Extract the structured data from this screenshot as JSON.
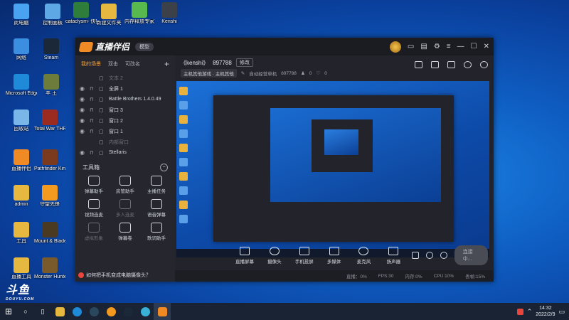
{
  "desktop": {
    "icons": [
      {
        "label": "此电脑",
        "icon": "pc-icon",
        "color": "#4aa3f0"
      },
      {
        "label": "控制面板",
        "icon": "control-panel-icon",
        "color": "#5fa8e6"
      },
      {
        "label": "cataclysm-\n快捷方式",
        "icon": "cataclysm-icon",
        "color": "#2f7d3a"
      },
      {
        "label": "新建文件夹",
        "icon": "folder-icon",
        "color": "#e7b83f"
      },
      {
        "label": "内存释放专家",
        "icon": "memory-tool-icon",
        "color": "#57b94e"
      },
      {
        "label": "Kenshi",
        "icon": "kenshi-icon",
        "color": "#3c4048"
      },
      {
        "label": "网络",
        "icon": "network-icon",
        "color": "#3b8ee0"
      },
      {
        "label": "Steam",
        "icon": "steam-icon",
        "color": "#1b2838"
      },
      {
        "label": "Microsoft Edge",
        "icon": "edge-icon",
        "color": "#1f8ad8"
      },
      {
        "label": "羊 王",
        "icon": "game-icon",
        "color": "#6d7c3a"
      },
      {
        "label": "回收站",
        "icon": "recycle-bin-icon",
        "color": "#7ab7e8"
      },
      {
        "label": "Total War THREE K...",
        "icon": "total-war-icon",
        "color": "#9b2b20"
      },
      {
        "label": "直播伴侣",
        "icon": "douyu-companion-icon",
        "color": "#f08a24"
      },
      {
        "label": "Pathfinder Kingmaker",
        "icon": "pathfinder-icon",
        "color": "#7b3a1e"
      },
      {
        "label": "admin",
        "icon": "user-folder-icon",
        "color": "#e7b83f"
      },
      {
        "label": "守望先锋",
        "icon": "overwatch-icon",
        "color": "#f29a1f"
      },
      {
        "label": "工具",
        "icon": "tools-folder-icon",
        "color": "#e7b83f"
      },
      {
        "label": "Mount & Blade II",
        "icon": "bannerlord-icon",
        "color": "#4a3a22"
      },
      {
        "label": "直播工具",
        "icon": "live-tools-icon",
        "color": "#e7b83f"
      },
      {
        "label": "Monster Hunter: W",
        "icon": "monster-hunter-icon",
        "color": "#7a5a2a"
      }
    ]
  },
  "window": {
    "app_name": "直播伴侣",
    "badge": "模型",
    "room_name": "《kenshi》",
    "room_id": "897788",
    "edit_label": "修改",
    "category": "主机其他游戏 · 主机其他",
    "auto_label": "自动经营单机",
    "viewers": "897788",
    "likes": "0",
    "hearts": "0",
    "sidebar_tabs": [
      "我的场景",
      "双击",
      "可改名"
    ],
    "scenes": [
      {
        "name": "文本 2",
        "dim": true
      },
      {
        "name": "全屏 1",
        "dim": false
      },
      {
        "name": "Battle Brothers 1.4.0.49",
        "dim": false
      },
      {
        "name": "窗口 3",
        "dim": false
      },
      {
        "name": "窗口 2",
        "dim": false
      },
      {
        "name": "窗口 1",
        "dim": false
      },
      {
        "name": "内部窗口",
        "dim": true
      },
      {
        "name": "Stellaris",
        "dim": false
      }
    ],
    "tools_title": "工具箱",
    "tools": [
      {
        "label": "弹幕助手",
        "dim": false
      },
      {
        "label": "房管助手",
        "dim": false
      },
      {
        "label": "主播任务",
        "dim": false
      },
      {
        "label": "视频连麦",
        "dim": false
      },
      {
        "label": "多人连麦",
        "dim": true
      },
      {
        "label": "语音弹幕",
        "dim": false
      },
      {
        "label": "虚拟形象",
        "dim": true
      },
      {
        "label": "弹幕卷",
        "dim": false
      },
      {
        "label": "歌词助手",
        "dim": false
      }
    ],
    "bottom_buttons": [
      "直播屏幕",
      "摄像头",
      "手机投屏",
      "多媒体",
      "麦克风",
      "扬声器"
    ],
    "live_button": "连接中...",
    "status": [
      "直播：0%",
      "FPS:30",
      "内存:0%",
      "CPU:10%",
      "丢帧:15%"
    ],
    "notice": "如何把手机变成电脑摄像头？"
  },
  "taskbar": {
    "time": "14:32",
    "date": "2022/2/9"
  },
  "watermark": {
    "logo": "斗鱼",
    "sub": "DOUYU.COM"
  }
}
